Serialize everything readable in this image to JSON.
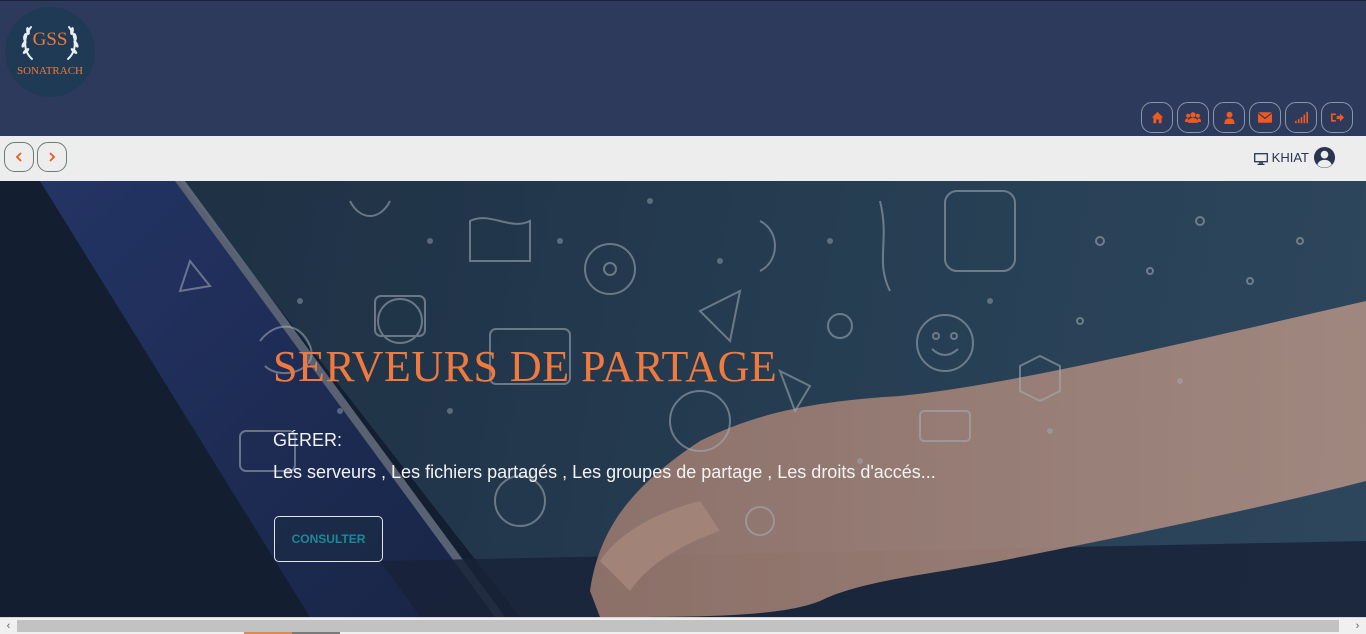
{
  "header": {
    "logo": {
      "top_text": "GSS",
      "bottom_text": "SONATRACH"
    },
    "toolbar": [
      {
        "icon": "home-icon",
        "name": "home-button"
      },
      {
        "icon": "users-icon",
        "name": "groups-button"
      },
      {
        "icon": "user-icon",
        "name": "user-button"
      },
      {
        "icon": "envelope-icon",
        "name": "mail-button"
      },
      {
        "icon": "signal-icon",
        "name": "stats-button"
      },
      {
        "icon": "sign-out-icon",
        "name": "logout-button"
      }
    ],
    "accent_color": "#f05a1e"
  },
  "navbar": {
    "prev_icon": "chevron-left-icon",
    "next_icon": "chevron-right-icon",
    "user": {
      "name": "KHIAT",
      "monitor_icon": "desktop-icon",
      "avatar_icon": "user-circle-icon"
    }
  },
  "hero": {
    "title": "SERVEURS DE PARTAGE",
    "subtitle": "GÉRER:",
    "description": "Les serveurs , Les fichiers partagés , Les groupes de partage , Les droits d'accés...",
    "button_label": "CONSULTER",
    "title_color": "#f07a3e",
    "button_text_color": "#1a8a98"
  },
  "scrollbar": {
    "left_arrow": "‹",
    "right_arrow": "›"
  }
}
